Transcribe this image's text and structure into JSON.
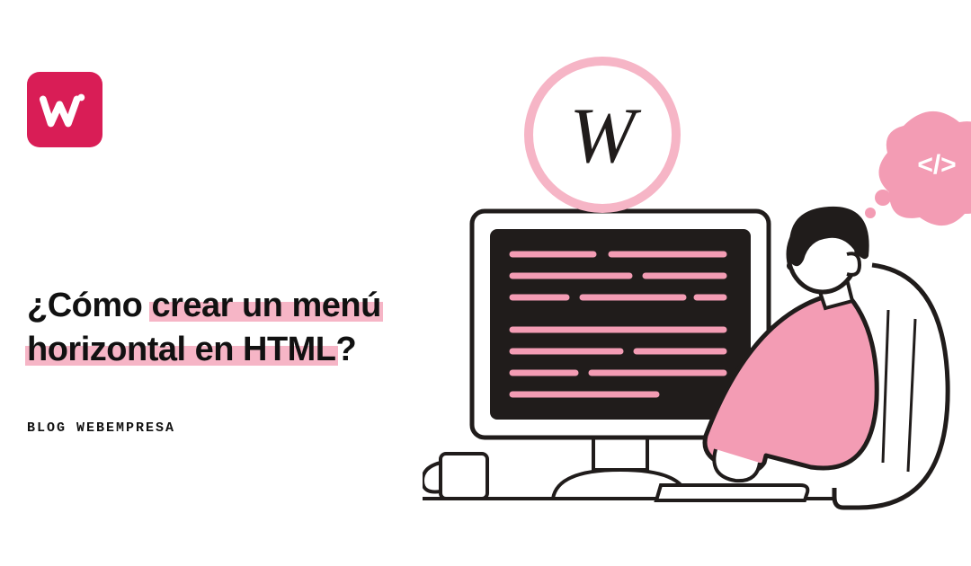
{
  "brand": {
    "name": "webempresa",
    "accent_color": "#d91d56",
    "pink": "#f6b5c6",
    "dark": "#201c1b"
  },
  "headline": {
    "prefix": "¿Cómo ",
    "highlight1": "crear un menú",
    "line2_highlight": "horizontal en HTML",
    "suffix": "?"
  },
  "kicker": "BLOG WEBEMPRESA",
  "badge": {
    "letter": "W"
  },
  "thought": {
    "symbol": "</>"
  }
}
